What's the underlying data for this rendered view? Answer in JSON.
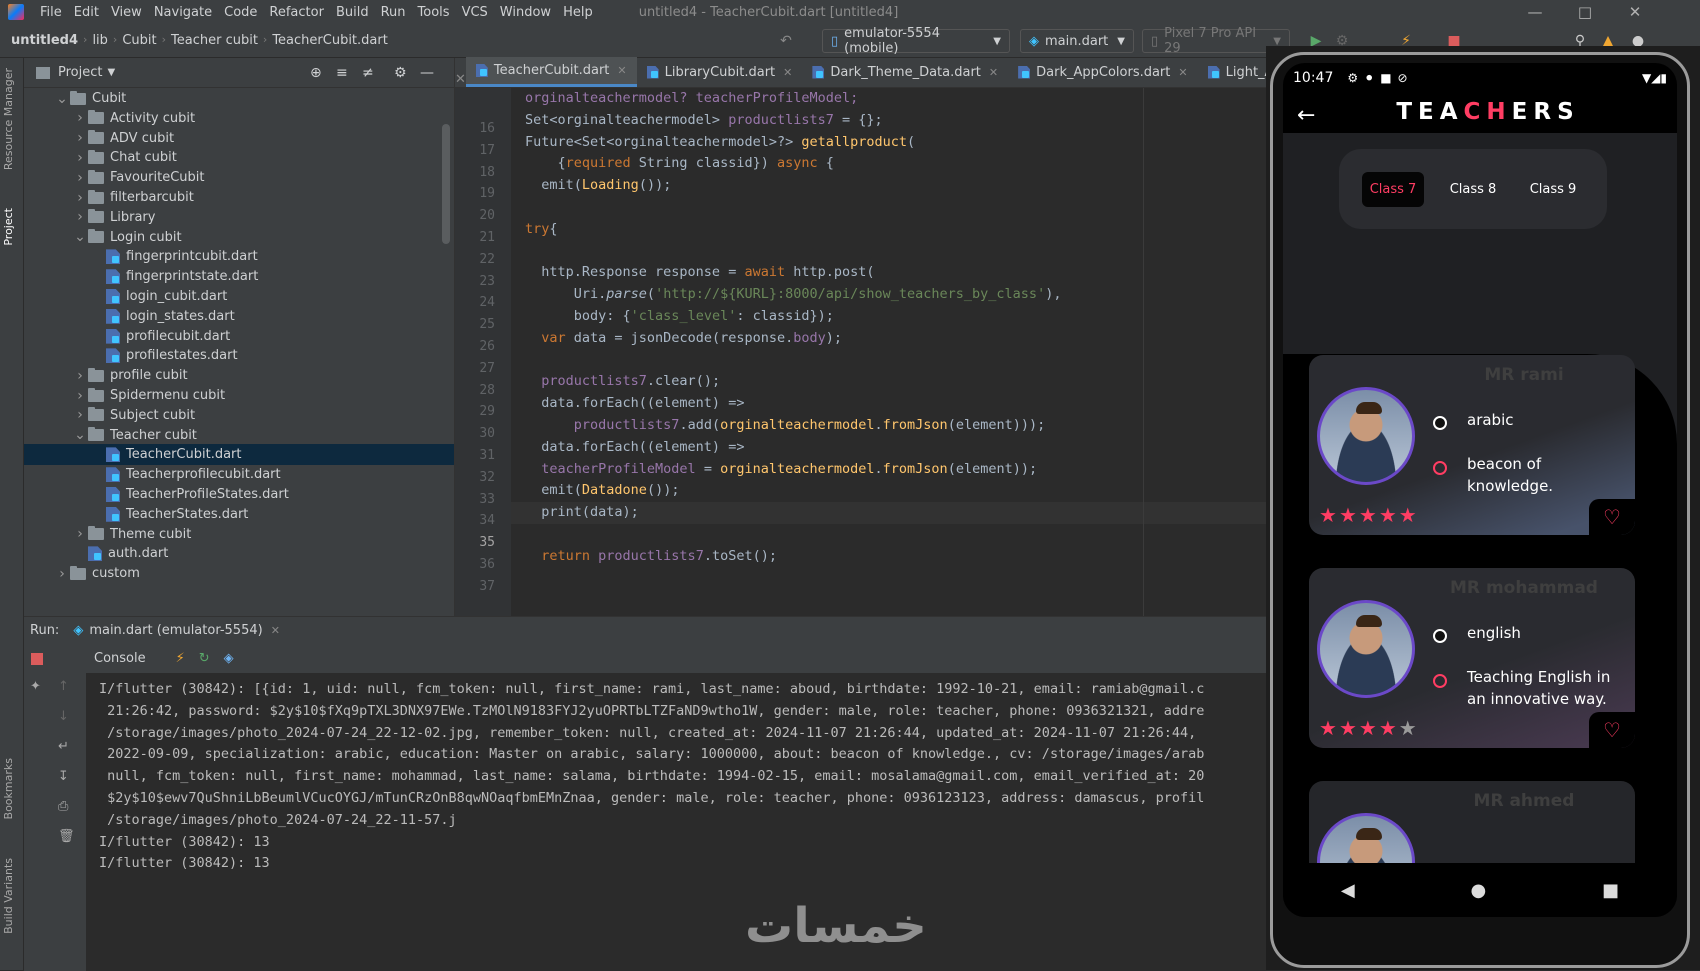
{
  "window": {
    "menu": [
      "File",
      "Edit",
      "View",
      "Navigate",
      "Code",
      "Refactor",
      "Build",
      "Run",
      "Tools",
      "VCS",
      "Window",
      "Help"
    ],
    "title": "untitled4 - TeacherCubit.dart [untitled4]"
  },
  "breadcrumb": [
    "untitled4",
    "lib",
    "Cubit",
    "Teacher cubit",
    "TeacherCubit.dart"
  ],
  "toolbar": {
    "device": "emulator-5554 (mobile)",
    "run_config": "main.dart",
    "avd": "Pixel 7 Pro API 29"
  },
  "side_tabs": {
    "resource_manager": "Resource Manager",
    "project": "Project",
    "bookmarks": "Bookmarks",
    "build_variants": "Build Variants"
  },
  "project_panel": {
    "title": "Project",
    "items": [
      {
        "label": "Cubit",
        "kind": "folder",
        "indent": 2,
        "open": true
      },
      {
        "label": "Activity cubit",
        "kind": "folder",
        "indent": 3
      },
      {
        "label": "ADV cubit",
        "kind": "folder",
        "indent": 3
      },
      {
        "label": "Chat cubit",
        "kind": "folder",
        "indent": 3
      },
      {
        "label": "FavouriteCubit",
        "kind": "folder",
        "indent": 3
      },
      {
        "label": "filterbarcubit",
        "kind": "folder",
        "indent": 3
      },
      {
        "label": "Library",
        "kind": "folder",
        "indent": 3
      },
      {
        "label": "Login cubit",
        "kind": "folder",
        "indent": 3,
        "open": true
      },
      {
        "label": "fingerprintcubit.dart",
        "kind": "file",
        "indent": 4
      },
      {
        "label": "fingerprintstate.dart",
        "kind": "file",
        "indent": 4
      },
      {
        "label": "login_cubit.dart",
        "kind": "file",
        "indent": 4
      },
      {
        "label": "login_states.dart",
        "kind": "file",
        "indent": 4
      },
      {
        "label": "profilecubit.dart",
        "kind": "file",
        "indent": 4
      },
      {
        "label": "profilestates.dart",
        "kind": "file",
        "indent": 4
      },
      {
        "label": "profile cubit",
        "kind": "folder",
        "indent": 3
      },
      {
        "label": "Spidermenu cubit",
        "kind": "folder",
        "indent": 3
      },
      {
        "label": "Subject cubit",
        "kind": "folder",
        "indent": 3
      },
      {
        "label": "Teacher cubit",
        "kind": "folder",
        "indent": 3,
        "open": true
      },
      {
        "label": "TeacherCubit.dart",
        "kind": "file",
        "indent": 4,
        "selected": true
      },
      {
        "label": "Teacherprofilecubit.dart",
        "kind": "file",
        "indent": 4
      },
      {
        "label": "TeacherProfileStates.dart",
        "kind": "file",
        "indent": 4
      },
      {
        "label": "TeacherStates.dart",
        "kind": "file",
        "indent": 4
      },
      {
        "label": "Theme cubit",
        "kind": "folder",
        "indent": 3
      },
      {
        "label": "auth.dart",
        "kind": "file",
        "indent": 3
      },
      {
        "label": "custom",
        "kind": "folder",
        "indent": 2
      }
    ]
  },
  "editor": {
    "tabs": [
      "TeacherCubit.dart",
      "LibraryCubit.dart",
      "Dark_Theme_Data.dart",
      "Dark_AppColors.dart",
      "Light_AppColors.d"
    ],
    "active_tab": 0,
    "current_line": 35,
    "lines": [
      {
        "n": "16",
        "segs": [
          [
            "fld",
            "orginalteachermodel? teacherProfileModel;"
          ]
        ]
      },
      {
        "n": "17",
        "segs": [
          [
            "ty",
            "Set<orginalteachermodel> "
          ],
          [
            "fld",
            "productlists7"
          ],
          [
            "ty",
            " = {};"
          ]
        ]
      },
      {
        "n": "18",
        "segs": [
          [
            "ty",
            "Future<Set<orginalteachermodel>?> "
          ],
          [
            "fn",
            "getallproduct"
          ],
          [
            "ty",
            "("
          ]
        ]
      },
      {
        "n": "19",
        "segs": [
          [
            "ty",
            "    {"
          ],
          [
            "kw",
            "required "
          ],
          [
            "ty",
            "String classid}) "
          ],
          [
            "kw",
            "async "
          ],
          [
            "ty",
            "{"
          ]
        ]
      },
      {
        "n": "20",
        "segs": [
          [
            "ty",
            "  emit("
          ],
          [
            "fn",
            "Loading"
          ],
          [
            "ty",
            "());"
          ]
        ]
      },
      {
        "n": "21",
        "segs": []
      },
      {
        "n": "22",
        "segs": [
          [
            "kw",
            "try"
          ],
          [
            "ty",
            "{"
          ]
        ]
      },
      {
        "n": "23",
        "segs": []
      },
      {
        "n": "24",
        "segs": [
          [
            "ty",
            "  http.Response response = "
          ],
          [
            "kw",
            "await "
          ],
          [
            "ty",
            "http.post("
          ]
        ]
      },
      {
        "n": "25",
        "segs": [
          [
            "ty",
            "      Uri."
          ],
          [
            "it",
            "parse"
          ],
          [
            "ty",
            "("
          ],
          [
            "str",
            "'http://${KURL}:8000/api/show_teachers_by_class'"
          ],
          [
            "ty",
            "),"
          ]
        ]
      },
      {
        "n": "26",
        "segs": [
          [
            "ty",
            "      body: {"
          ],
          [
            "str",
            "'class_level'"
          ],
          [
            "ty",
            ": classid});"
          ]
        ]
      },
      {
        "n": "27",
        "segs": [
          [
            "kw",
            "  var "
          ],
          [
            "ty",
            "data = jsonDecode(response."
          ],
          [
            "fld",
            "body"
          ],
          [
            "ty",
            ");"
          ]
        ]
      },
      {
        "n": "28",
        "segs": []
      },
      {
        "n": "29",
        "segs": [
          [
            "fld",
            "  productlists7"
          ],
          [
            "ty",
            ".clear();"
          ]
        ]
      },
      {
        "n": "30",
        "segs": [
          [
            "ty",
            "  data.forEach((element) =>"
          ]
        ]
      },
      {
        "n": "31",
        "segs": [
          [
            "fld",
            "      productlists7"
          ],
          [
            "ty",
            ".add("
          ],
          [
            "fn",
            "orginalteachermodel"
          ],
          [
            "ty",
            "."
          ],
          [
            "fn",
            "fromJson"
          ],
          [
            "ty",
            "(element)));"
          ]
        ]
      },
      {
        "n": "32",
        "segs": [
          [
            "ty",
            "  data.forEach((element) =>"
          ]
        ]
      },
      {
        "n": "33",
        "segs": [
          [
            "fld",
            "  teacherProfileModel"
          ],
          [
            "ty",
            " = "
          ],
          [
            "fn",
            "orginalteachermodel"
          ],
          [
            "ty",
            "."
          ],
          [
            "fn",
            "fromJson"
          ],
          [
            "ty",
            "(element));"
          ]
        ]
      },
      {
        "n": "34",
        "segs": [
          [
            "ty",
            "  emit("
          ],
          [
            "fn",
            "Datadone"
          ],
          [
            "ty",
            "());"
          ]
        ]
      },
      {
        "n": "35",
        "segs": [
          [
            "ty",
            "  print(data);"
          ]
        ]
      },
      {
        "n": "36",
        "segs": []
      },
      {
        "n": "37",
        "segs": [
          [
            "kw",
            "  return "
          ],
          [
            "fld",
            "productlists7"
          ],
          [
            "ty",
            ".toSet();"
          ]
        ]
      }
    ]
  },
  "run_panel": {
    "label": "Run:",
    "config": "main.dart (emulator-5554)",
    "console_tab": "Console",
    "output": [
      "I/flutter (30842): [{id: 1, uid: null, fcm_token: null, first_name: rami, last_name: aboud, birthdate: 1992-10-21, email: ramiab@gmail.c",
      " 21:26:42, password: $2y$10$fXq9pTXL3DNX97EWe.TzMOlN9183FYJ2yuOPRTbLTZFaND9wtho1W, gender: male, role: teacher, phone: 0936321321, addre",
      " /storage/images/photo_2024-07-24_22-12-02.jpg, remember_token: null, created_at: 2024-11-07 21:26:44, updated_at: 2024-11-07 21:26:44,",
      " 2022-09-09, specialization: arabic, education: Master on arabic, salary: 1000000, about: beacon of knowledge., cv: /storage/images/arab",
      " null, fcm_token: null, first_name: mohammad, last_name: salama, birthdate: 1994-02-15, email: mosalama@gmail.com, email_verified_at: 20",
      " $2y$10$ewv7QuShniLbBeumlVCucOYGJ/mTunCRzOnB8qwNOaqfbmEMnZnaa, gender: male, role: teacher, phone: 0936123123, address: damascus, profil",
      " /storage/images/photo_2024-07-24_22-11-57.j",
      "I/flutter (30842): 13",
      "I/flutter (30842): 13"
    ]
  },
  "watermark": "خمسات",
  "phone": {
    "time": "10:47",
    "title_parts": [
      "TEA",
      "CH",
      "ERS"
    ],
    "classes": [
      "Class 7",
      "Class 8",
      "Class 9"
    ],
    "active_class": 0,
    "teachers": [
      {
        "name": "MR rami",
        "subject": "arabic",
        "about": "beacon of knowledge.",
        "rating": 5
      },
      {
        "name": "MR mohammad",
        "subject": "english",
        "about": "Teaching English in an innovative way.",
        "rating": 4
      },
      {
        "name": "MR ahmed",
        "subject": "",
        "about": "",
        "rating": 0
      }
    ],
    "colors": {
      "accent": "#ff3d63",
      "avatar_ring": "#6b49c8"
    }
  }
}
